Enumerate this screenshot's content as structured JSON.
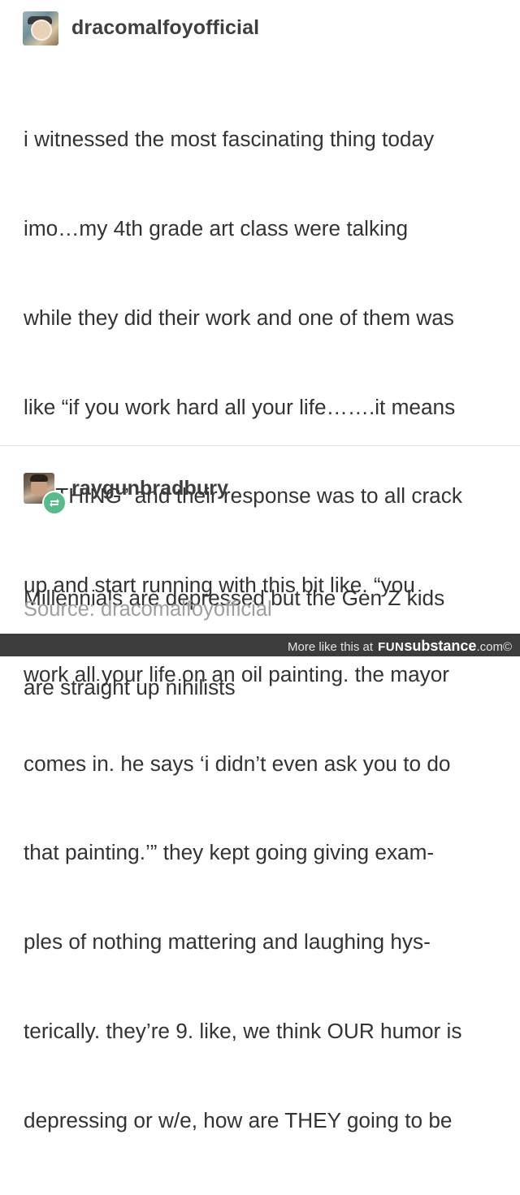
{
  "post": {
    "username": "dracomalfoyofficial",
    "body_lines": [
      "i witnessed the most fascinating thing today",
      "imo…my 4th grade art class were talking",
      "while they did their work and one of them was",
      "like “if you work hard all your life…….it means",
      "NOTHING” and their response was to all crack",
      "up and start running with this bit like. “you",
      "work all your life on an oil painting. the mayor",
      "comes in. he says ‘i didn’t even ask you to do",
      "that painting.’” they kept going giving exam-",
      "ples of nothing mattering and laughing hys-",
      "terically. they’re 9. like, we think OUR humor is",
      "depressing or w/e, how are THEY going to be"
    ]
  },
  "reblog": {
    "username": "raygunbradbury",
    "body_lines": [
      "Millennials are depressed but the Gen Z kids",
      "are straight up nihilists"
    ],
    "source": "Source: dracomalfoyofficial",
    "badge_icon": "reblog-icon",
    "badge_color": "#56bc8a"
  },
  "footer": {
    "prefix": "More like this at",
    "brand_a": "FUN",
    "brand_b": "substance",
    "brand_c": ".com©"
  }
}
